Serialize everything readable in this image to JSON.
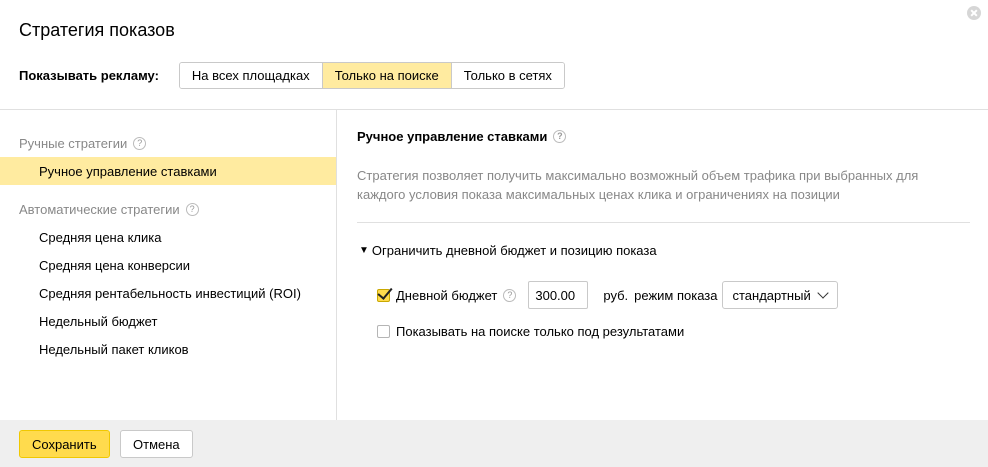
{
  "dialog": {
    "title": "Стратегия показов"
  },
  "show_ads": {
    "label": "Показывать рекламу:",
    "options": [
      "На всех площадках",
      "Только на поиске",
      "Только в сетях"
    ],
    "selected": "Только на поиске"
  },
  "sidebar": {
    "manual_group": {
      "title": "Ручные стратегии",
      "items": [
        "Ручное управление ставками"
      ]
    },
    "auto_group": {
      "title": "Автоматические стратегии",
      "items": [
        "Средняя цена клика",
        "Средняя цена конверсии",
        "Средняя рентабельность инвестиций (ROI)",
        "Недельный бюджет",
        "Недельный пакет кликов"
      ]
    },
    "active": "Ручное управление ставками"
  },
  "main": {
    "title": "Ручное управление ставками",
    "description": "Стратегия позволяет получить максимально возможный объем трафика при выбранных для каждого условия показа максимальных ценах клика и ограничениях на позиции",
    "limit_toggle": "Ограничить дневной бюджет и позицию показа",
    "daily_budget": {
      "label": "Дневной бюджет",
      "checked": true,
      "value": "300.00",
      "currency": "руб.",
      "mode_label": "режим показа",
      "mode_value": "стандартный"
    },
    "search_only": {
      "label": "Показывать на поиске только под результатами",
      "checked": false
    }
  },
  "footer": {
    "save": "Сохранить",
    "cancel": "Отмена"
  },
  "colors": {
    "accent": "#ffdb4d",
    "selected_bg": "#ffeba0",
    "muted_text": "#888888"
  },
  "icons": {
    "close": "close-icon",
    "help": "question-icon",
    "toggle": "triangle-down-icon",
    "dropdown": "chevron-down-icon"
  }
}
